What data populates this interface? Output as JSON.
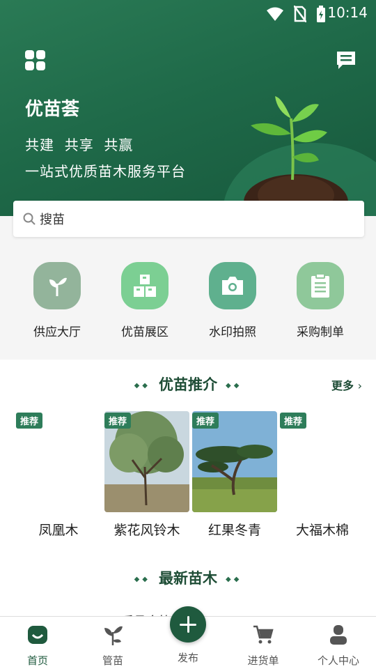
{
  "status_bar": {
    "time": "10:14"
  },
  "header": {
    "brand": "优苗荟",
    "slogan": "共建  共享  共赢",
    "tagline": "一站式优质苗木服务平台"
  },
  "search": {
    "placeholder": "搜苗"
  },
  "quick_entries": [
    {
      "label": "供应大厅",
      "icon": "sprout-icon",
      "color": "#93b49b"
    },
    {
      "label": "优苗展区",
      "icon": "boxes-icon",
      "color": "#7ccf93"
    },
    {
      "label": "水印拍照",
      "icon": "camera-icon",
      "color": "#5fb08e"
    },
    {
      "label": "采购制单",
      "icon": "clipboard-icon",
      "color": "#8fc89a"
    }
  ],
  "recommend": {
    "title": "优苗推介",
    "more": "更多",
    "cards": [
      {
        "tag": "推荐",
        "name": "凤凰木"
      },
      {
        "tag": "推荐",
        "name": "紫花风铃木"
      },
      {
        "tag": "推荐",
        "name": "红果冬青"
      },
      {
        "tag": "推荐",
        "name": "大福木棉"
      }
    ]
  },
  "latest": {
    "title": "最新苗木",
    "partial_text": "乐昌含笑"
  },
  "nav": {
    "tabs": [
      {
        "label": "首页"
      },
      {
        "label": "管苗"
      },
      {
        "label": "发布"
      },
      {
        "label": "进货单"
      },
      {
        "label": "个人中心"
      }
    ]
  },
  "colors": {
    "brand_green": "#1f6a49",
    "accent": "#2e7d5a"
  }
}
